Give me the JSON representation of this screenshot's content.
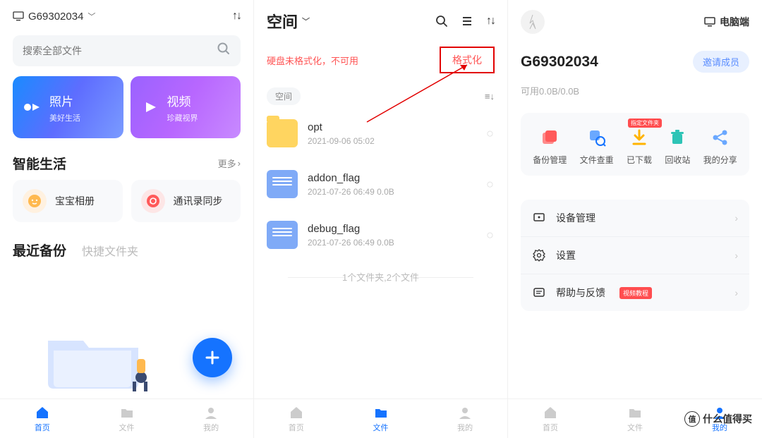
{
  "panel1": {
    "device_id": "G69302034",
    "search_placeholder": "搜索全部文件",
    "cards": {
      "photo": {
        "title": "照片",
        "sub": "美好生活"
      },
      "video": {
        "title": "视频",
        "sub": "珍藏视界"
      }
    },
    "smart_title": "智能生活",
    "more": "更多",
    "tiles": {
      "baby": "宝宝相册",
      "contacts": "通讯录同步"
    },
    "tab_active": "最近备份",
    "tab_inactive": "快捷文件夹"
  },
  "panel2": {
    "title": "空间",
    "alert": "硬盘未格式化，不可用",
    "format_btn": "格式化",
    "crumb": "空间",
    "files": [
      {
        "name": "opt",
        "meta": "2021-09-06 05:02",
        "type": "folder"
      },
      {
        "name": "addon_flag",
        "meta": "2021-07-26 06:49  0.0B",
        "type": "doc"
      },
      {
        "name": "debug_flag",
        "meta": "2021-07-26 06:49  0.0B",
        "type": "doc"
      }
    ],
    "summary": "1个文件夹,2个文件"
  },
  "panel3": {
    "pc_label": "电脑端",
    "device_id": "G69302034",
    "invite": "邀请成员",
    "usage": "可用0.0B/0.0B",
    "tools": [
      {
        "label": "备份管理"
      },
      {
        "label": "文件查重"
      },
      {
        "label": "已下载",
        "badge": "指定文件夹"
      },
      {
        "label": "回收站"
      },
      {
        "label": "我的分享"
      }
    ],
    "menu": [
      {
        "label": "设备管理"
      },
      {
        "label": "设置"
      },
      {
        "label": "帮助与反馈",
        "badge": "视频教程"
      }
    ]
  },
  "bottom_nav": {
    "home": "首页",
    "files": "文件",
    "mine": "我的"
  },
  "watermark": "什么值得买"
}
